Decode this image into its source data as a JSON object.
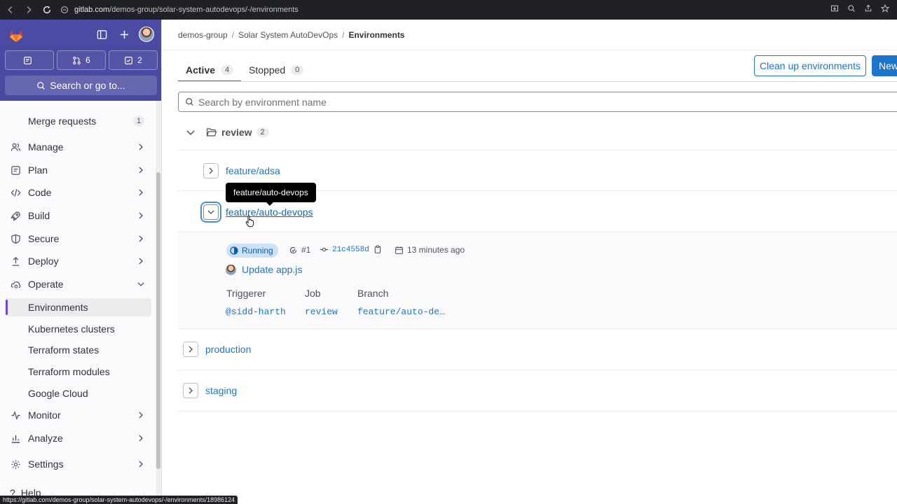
{
  "browser": {
    "url_domain": "gitlab.com",
    "url_path": "/demos-group/solar-system-autodevops/-/environments",
    "status_url": "https://gitlab.com/demos-group/solar-system-autodevops/-/environments/18986124"
  },
  "sidebar": {
    "counters": {
      "issues": "",
      "merge_requests": "6",
      "todos": "2"
    },
    "search_label": "Search or go to...",
    "items": [
      {
        "label": "Merge requests",
        "badge": "1"
      },
      {
        "label": "Manage"
      },
      {
        "label": "Plan"
      },
      {
        "label": "Code"
      },
      {
        "label": "Build"
      },
      {
        "label": "Secure"
      },
      {
        "label": "Deploy"
      },
      {
        "label": "Operate"
      },
      {
        "label": "Environments"
      },
      {
        "label": "Kubernetes clusters"
      },
      {
        "label": "Terraform states"
      },
      {
        "label": "Terraform modules"
      },
      {
        "label": "Google Cloud"
      },
      {
        "label": "Monitor"
      },
      {
        "label": "Analyze"
      },
      {
        "label": "Settings"
      }
    ],
    "help": "Help"
  },
  "breadcrumb": {
    "group": "demos-group",
    "project": "Solar System AutoDevOps",
    "current": "Environments"
  },
  "tabs": [
    {
      "label": "Active",
      "count": "4"
    },
    {
      "label": "Stopped",
      "count": "0"
    }
  ],
  "buttons": {
    "cleanup": "Clean up environments",
    "new": "New"
  },
  "search": {
    "placeholder": "Search by environment name"
  },
  "folder": {
    "name": "review",
    "count": "2"
  },
  "environments": [
    {
      "name": "feature/adsa"
    },
    {
      "name": "feature/auto-devops"
    },
    {
      "name": "production"
    },
    {
      "name": "staging"
    }
  ],
  "tooltip": "feature/auto-devops",
  "deployment": {
    "status": "Running",
    "number": "#1",
    "sha": "21c4558d",
    "time": "13 minutes ago",
    "commit_message": "Update app.js",
    "labels": {
      "triggerer": "Triggerer",
      "job": "Job",
      "branch": "Branch"
    },
    "triggerer": "@sidd-harth",
    "job": "review",
    "branch": "feature/auto-de…"
  },
  "colors": {
    "accent": "#1f75cb",
    "sidebar_header": "#4b4ba3",
    "running_bg": "#cbe2f9"
  }
}
